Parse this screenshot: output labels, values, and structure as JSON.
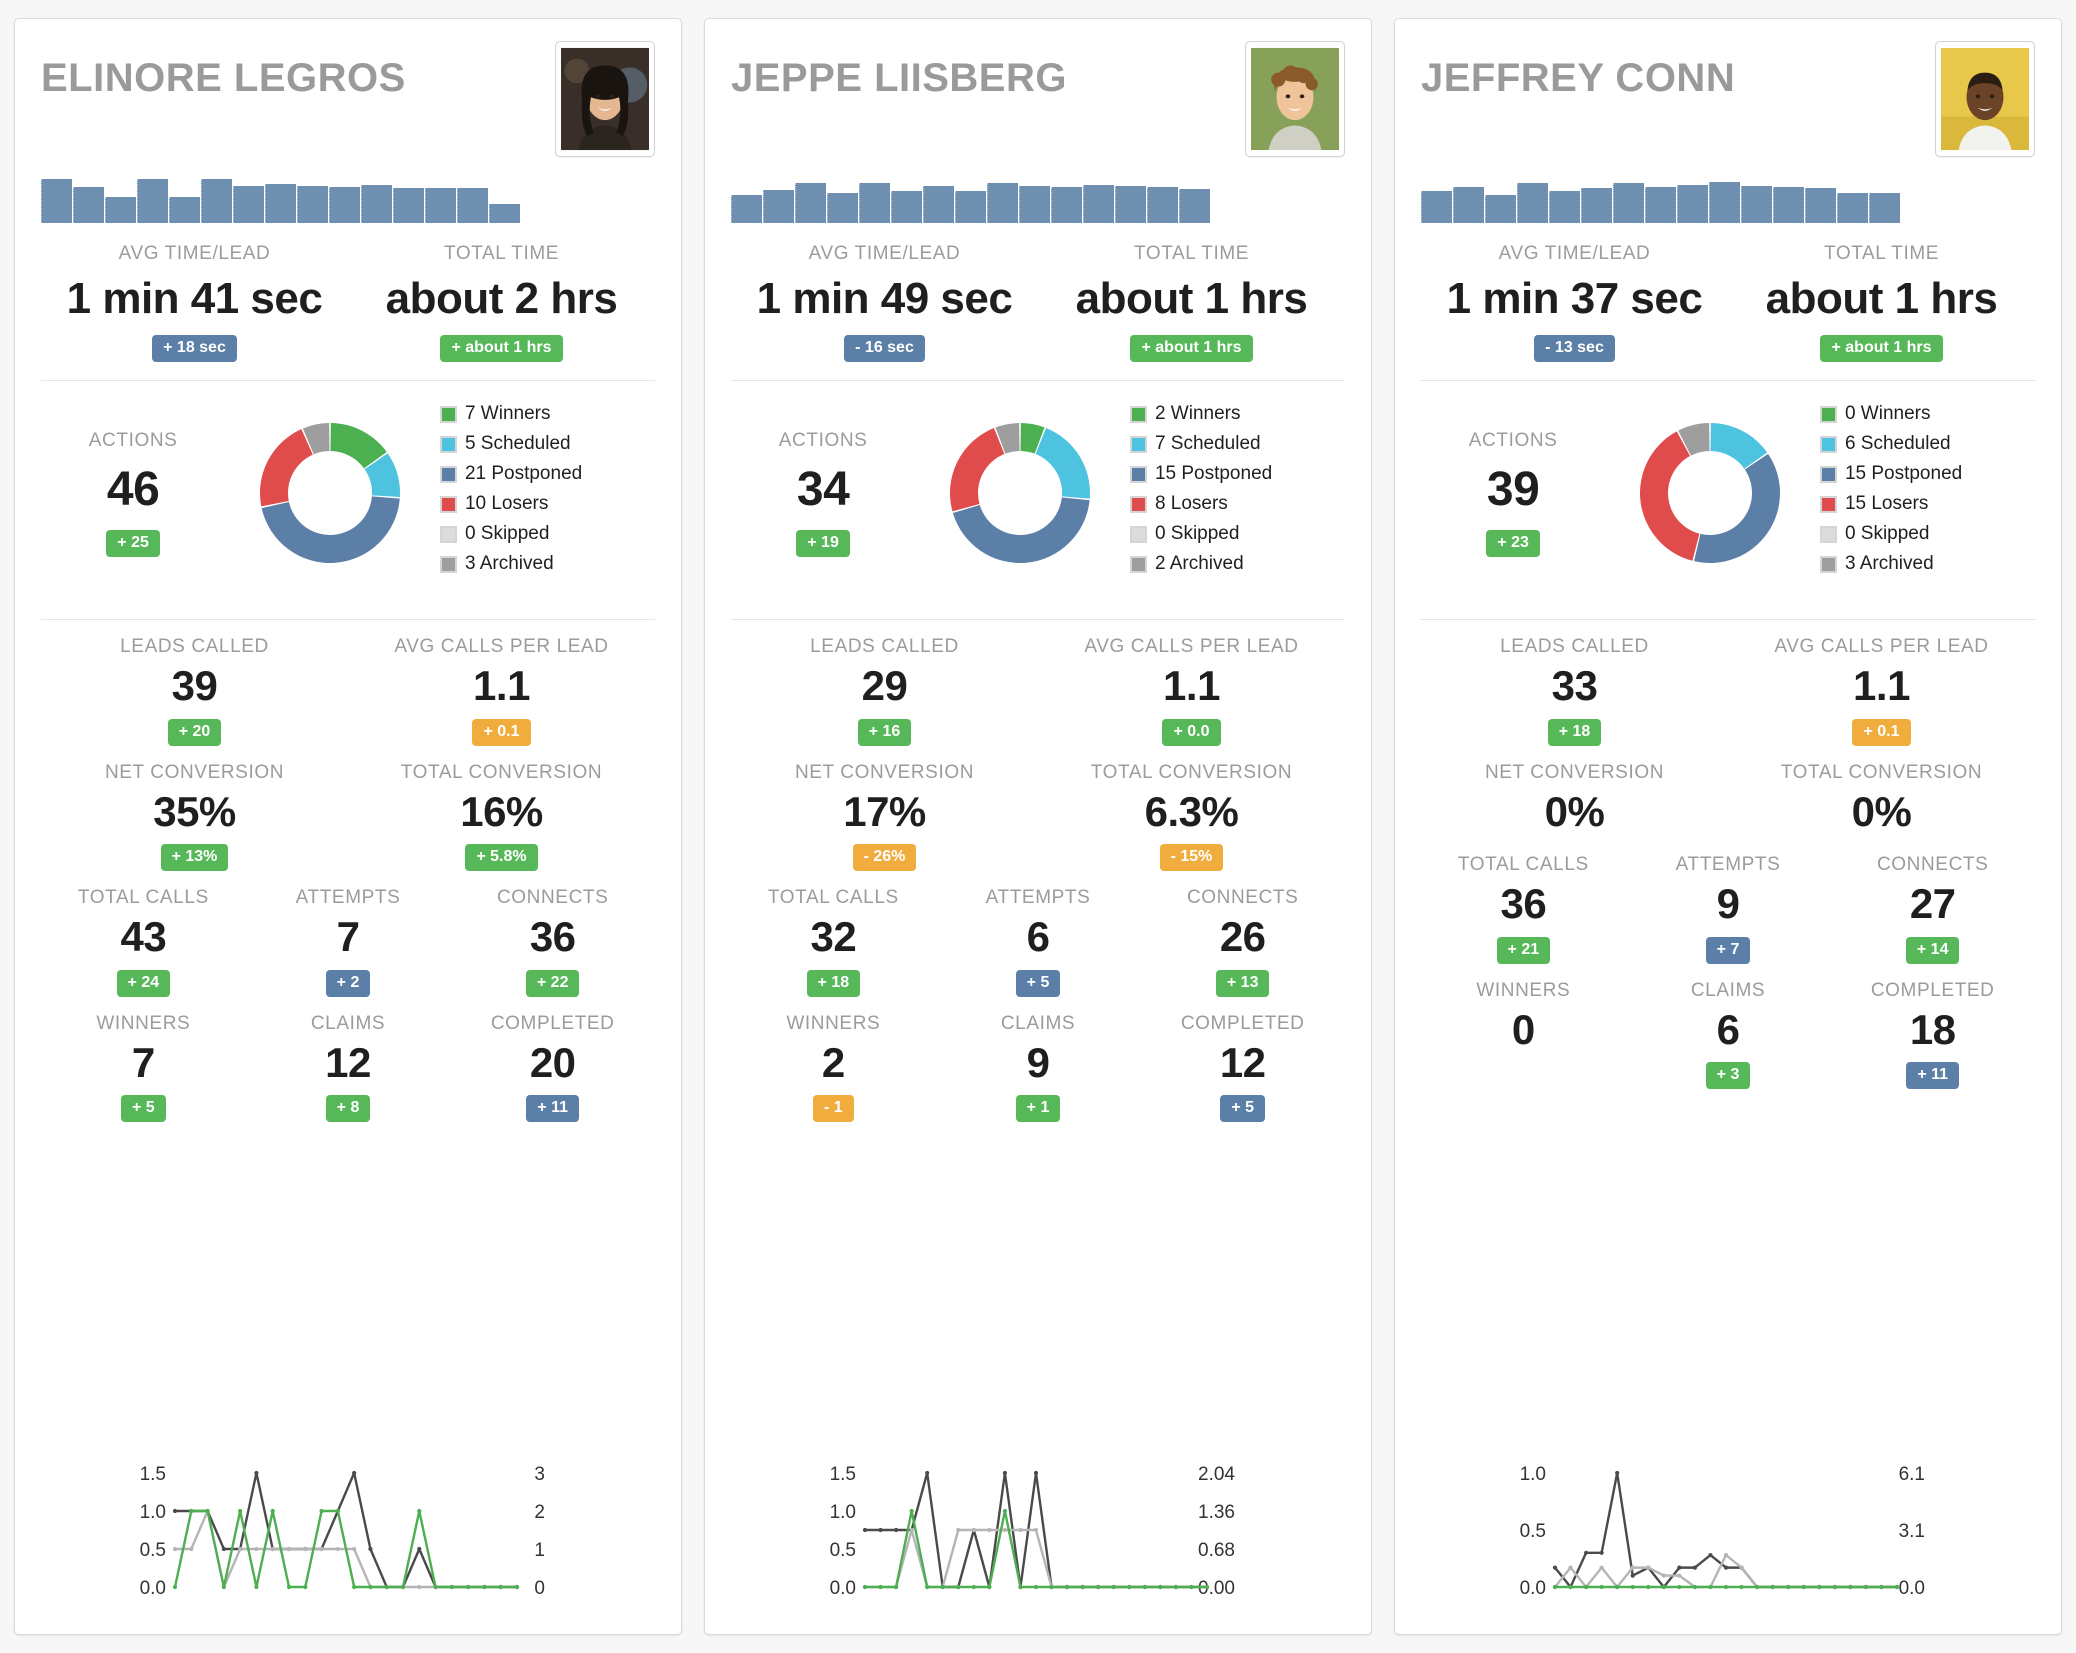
{
  "colors": {
    "winners": "#4caf50",
    "scheduled": "#4ec3e0",
    "postponed": "#5b7fa6",
    "losers": "#e04b4b",
    "skipped": "#dcdcdc",
    "archived": "#9e9e9e",
    "bar": "#6e8fb0",
    "green_badge": "#57b85a",
    "blue_badge": "#5b7fa6",
    "orange_badge": "#f0ad3e",
    "label_gray": "#9b9b9b",
    "line_dark": "#4a4a4a",
    "line_light": "#b5b5b5",
    "line_green": "#4caf50"
  },
  "labels": {
    "avg_time_lead": "AVG TIME/LEAD",
    "total_time": "TOTAL TIME",
    "actions": "ACTIONS",
    "leads_called": "LEADS CALLED",
    "avg_calls_per_lead": "AVG CALLS PER LEAD",
    "net_conversion": "NET CONVERSION",
    "total_conversion": "TOTAL CONVERSION",
    "total_calls": "TOTAL CALLS",
    "attempts": "ATTEMPTS",
    "connects": "CONNECTS",
    "winners": "WINNERS",
    "claims": "CLAIMS",
    "completed": "COMPLETED"
  },
  "legend_names": [
    "Winners",
    "Scheduled",
    "Postponed",
    "Losers",
    "Skipped",
    "Archived"
  ],
  "cards": [
    {
      "name": "ELINORE LEGROS",
      "avatar": "avatar-woman-dark-hair",
      "sparkbars": [
        92,
        74,
        55,
        92,
        55,
        92,
        78,
        82,
        78,
        74,
        80,
        72,
        72,
        72,
        40
      ],
      "avg_time_lead": {
        "value": "1 min 41 sec",
        "delta": "+ 18 sec",
        "delta_color": "blue"
      },
      "total_time": {
        "value": "about 2 hrs",
        "delta": "+ about 1 hrs",
        "delta_color": "green"
      },
      "actions": {
        "value": "46",
        "delta": "+ 25",
        "delta_color": "green"
      },
      "donut": {
        "winners": 7,
        "scheduled": 5,
        "postponed": 21,
        "losers": 10,
        "skipped": 0,
        "archived": 3
      },
      "legend": [
        "7 Winners",
        "5 Scheduled",
        "21 Postponed",
        "10 Losers",
        "0 Skipped",
        "3 Archived"
      ],
      "leads_called": {
        "value": "39",
        "delta": "+ 20",
        "delta_color": "green"
      },
      "avg_calls_per_lead": {
        "value": "1.1",
        "delta": "+ 0.1",
        "delta_color": "orange"
      },
      "net_conversion": {
        "value": "35%",
        "delta": "+ 13%",
        "delta_color": "green"
      },
      "total_conversion": {
        "value": "16%",
        "delta": "+ 5.8%",
        "delta_color": "green"
      },
      "total_calls": {
        "value": "43",
        "delta": "+ 24",
        "delta_color": "green"
      },
      "attempts": {
        "value": "7",
        "delta": "+ 2",
        "delta_color": "blue"
      },
      "connects": {
        "value": "36",
        "delta": "+ 22",
        "delta_color": "green"
      },
      "winners": {
        "value": "7",
        "delta": "+ 5",
        "delta_color": "green"
      },
      "claims": {
        "value": "12",
        "delta": "+ 8",
        "delta_color": "green"
      },
      "completed": {
        "value": "20",
        "delta": "+ 11",
        "delta_color": "blue"
      },
      "chart_data": {
        "type": "line",
        "title": "",
        "left_ticks": [
          "1.5",
          "1.0",
          "0.5",
          "0.0"
        ],
        "right_ticks": [
          "3",
          "2",
          "1",
          "0"
        ],
        "left_range": [
          0,
          1.5
        ],
        "right_range": [
          0,
          3
        ],
        "grid": false,
        "legend_position": "none",
        "series": [
          {
            "name": "dark",
            "color": "#4a4a4a",
            "values": [
              1.0,
              1.0,
              1.0,
              0.5,
              0.5,
              1.5,
              0.5,
              0.5,
              0.5,
              0.5,
              1.0,
              1.5,
              0.5,
              0.0,
              0.0,
              0.5,
              0.0,
              0.0,
              0.0,
              0.0,
              0.0,
              0.0
            ]
          },
          {
            "name": "light",
            "color": "#b5b5b5",
            "values": [
              0.5,
              0.5,
              1.0,
              0.0,
              0.5,
              0.5,
              0.5,
              0.5,
              0.5,
              0.5,
              0.5,
              0.5,
              0.0,
              0.0,
              0.0,
              0.0,
              0.0,
              0.0,
              0.0,
              0.0,
              0.0,
              0.0
            ]
          },
          {
            "name": "green",
            "color": "#4caf50",
            "values": [
              0.0,
              1.0,
              1.0,
              0.0,
              1.0,
              0.0,
              1.0,
              0.0,
              0.0,
              1.0,
              1.0,
              0.0,
              0.0,
              0.0,
              0.0,
              1.0,
              0.0,
              0.0,
              0.0,
              0.0,
              0.0,
              0.0
            ]
          }
        ]
      }
    },
    {
      "name": "JEPPE LIISBERG",
      "avatar": "avatar-young-man-curly-hair",
      "sparkbars": [
        58,
        68,
        84,
        62,
        84,
        66,
        78,
        66,
        84,
        78,
        74,
        80,
        78,
        76,
        70
      ],
      "avg_time_lead": {
        "value": "1 min 49 sec",
        "delta": "- 16 sec",
        "delta_color": "blue"
      },
      "total_time": {
        "value": "about 1 hrs",
        "delta": "+ about 1 hrs",
        "delta_color": "green"
      },
      "actions": {
        "value": "34",
        "delta": "+ 19",
        "delta_color": "green"
      },
      "donut": {
        "winners": 2,
        "scheduled": 7,
        "postponed": 15,
        "losers": 8,
        "skipped": 0,
        "archived": 2
      },
      "legend": [
        "2 Winners",
        "7 Scheduled",
        "15 Postponed",
        "8 Losers",
        "0 Skipped",
        "2 Archived"
      ],
      "leads_called": {
        "value": "29",
        "delta": "+ 16",
        "delta_color": "green"
      },
      "avg_calls_per_lead": {
        "value": "1.1",
        "delta": "+ 0.0",
        "delta_color": "green"
      },
      "net_conversion": {
        "value": "17%",
        "delta": "- 26%",
        "delta_color": "orange"
      },
      "total_conversion": {
        "value": "6.3%",
        "delta": "- 15%",
        "delta_color": "orange"
      },
      "total_calls": {
        "value": "32",
        "delta": "+ 18",
        "delta_color": "green"
      },
      "attempts": {
        "value": "6",
        "delta": "+ 5",
        "delta_color": "blue"
      },
      "connects": {
        "value": "26",
        "delta": "+ 13",
        "delta_color": "green"
      },
      "winners": {
        "value": "2",
        "delta": "- 1",
        "delta_color": "orange"
      },
      "claims": {
        "value": "9",
        "delta": "+ 1",
        "delta_color": "green"
      },
      "completed": {
        "value": "12",
        "delta": "+ 5",
        "delta_color": "blue"
      },
      "chart_data": {
        "type": "line",
        "title": "",
        "left_ticks": [
          "1.5",
          "1.0",
          "0.5",
          "0.0"
        ],
        "right_ticks": [
          "2.04",
          "1.36",
          "0.68",
          "0.00"
        ],
        "left_range": [
          0,
          1.5
        ],
        "right_range": [
          0,
          2.04
        ],
        "grid": false,
        "legend_position": "none",
        "series": [
          {
            "name": "dark",
            "color": "#4a4a4a",
            "values": [
              0.75,
              0.75,
              0.75,
              0.75,
              1.5,
              0.0,
              0.0,
              0.75,
              0.0,
              1.5,
              0.0,
              1.5,
              0.0,
              0.0,
              0.0,
              0.0,
              0.0,
              0.0,
              0.0,
              0.0,
              0.0,
              0.0,
              0.0
            ]
          },
          {
            "name": "light",
            "color": "#b5b5b5",
            "values": [
              0.0,
              0.0,
              0.0,
              0.75,
              0.0,
              0.0,
              0.75,
              0.75,
              0.75,
              0.75,
              0.75,
              0.75,
              0.0,
              0.0,
              0.0,
              0.0,
              0.0,
              0.0,
              0.0,
              0.0,
              0.0,
              0.0,
              0.0
            ]
          },
          {
            "name": "green",
            "color": "#4caf50",
            "values": [
              0.0,
              0.0,
              0.0,
              1.0,
              0.0,
              0.0,
              0.0,
              0.0,
              0.0,
              1.0,
              0.0,
              0.0,
              0.0,
              0.0,
              0.0,
              0.0,
              0.0,
              0.0,
              0.0,
              0.0,
              0.0,
              0.0,
              0.0
            ]
          }
        ]
      }
    },
    {
      "name": "JEFFREY CONN",
      "avatar": "avatar-man-yellow-background",
      "sparkbars": [
        66,
        74,
        58,
        84,
        66,
        72,
        84,
        74,
        80,
        86,
        78,
        74,
        72,
        62,
        62
      ],
      "avg_time_lead": {
        "value": "1 min 37 sec",
        "delta": "- 13 sec",
        "delta_color": "blue"
      },
      "total_time": {
        "value": "about 1 hrs",
        "delta": "+ about 1 hrs",
        "delta_color": "green"
      },
      "actions": {
        "value": "39",
        "delta": "+ 23",
        "delta_color": "green"
      },
      "donut": {
        "winners": 0,
        "scheduled": 6,
        "postponed": 15,
        "losers": 15,
        "skipped": 0,
        "archived": 3
      },
      "legend": [
        "0 Winners",
        "6 Scheduled",
        "15 Postponed",
        "15 Losers",
        "0 Skipped",
        "3 Archived"
      ],
      "leads_called": {
        "value": "33",
        "delta": "+ 18",
        "delta_color": "green"
      },
      "avg_calls_per_lead": {
        "value": "1.1",
        "delta": "+ 0.1",
        "delta_color": "orange"
      },
      "net_conversion": {
        "value": "0%",
        "delta": "",
        "delta_color": "none"
      },
      "total_conversion": {
        "value": "0%",
        "delta": "",
        "delta_color": "none"
      },
      "total_calls": {
        "value": "36",
        "delta": "+ 21",
        "delta_color": "green"
      },
      "attempts": {
        "value": "9",
        "delta": "+ 7",
        "delta_color": "blue"
      },
      "connects": {
        "value": "27",
        "delta": "+ 14",
        "delta_color": "green"
      },
      "winners": {
        "value": "0",
        "delta": "",
        "delta_color": "none"
      },
      "claims": {
        "value": "6",
        "delta": "+ 3",
        "delta_color": "green"
      },
      "completed": {
        "value": "18",
        "delta": "+ 11",
        "delta_color": "blue"
      },
      "chart_data": {
        "type": "line",
        "title": "",
        "left_ticks": [
          "1.0",
          "0.5",
          "0.0"
        ],
        "right_ticks": [
          "6.1",
          "3.1",
          "0.0"
        ],
        "left_range": [
          0,
          1.0
        ],
        "right_range": [
          0,
          6.1
        ],
        "grid": false,
        "legend_position": "none",
        "series": [
          {
            "name": "dark",
            "color": "#4a4a4a",
            "values": [
              0.17,
              0.0,
              0.3,
              0.3,
              1.0,
              0.1,
              0.17,
              0.0,
              0.17,
              0.17,
              0.28,
              0.17,
              0.17,
              0.0,
              0.0,
              0.0,
              0.0,
              0.0,
              0.0,
              0.0,
              0.0,
              0.0,
              0.0
            ]
          },
          {
            "name": "light",
            "color": "#b5b5b5",
            "values": [
              0.0,
              0.17,
              0.0,
              0.17,
              0.0,
              0.17,
              0.17,
              0.1,
              0.1,
              0.0,
              0.0,
              0.28,
              0.17,
              0.0,
              0.0,
              0.0,
              0.0,
              0.0,
              0.0,
              0.0,
              0.0,
              0.0,
              0.0
            ]
          },
          {
            "name": "green",
            "color": "#4caf50",
            "values": [
              0.0,
              0.0,
              0.0,
              0.0,
              0.0,
              0.0,
              0.0,
              0.0,
              0.0,
              0.0,
              0.0,
              0.0,
              0.0,
              0.0,
              0.0,
              0.0,
              0.0,
              0.0,
              0.0,
              0.0,
              0.0,
              0.0,
              0.0
            ]
          }
        ]
      }
    }
  ]
}
